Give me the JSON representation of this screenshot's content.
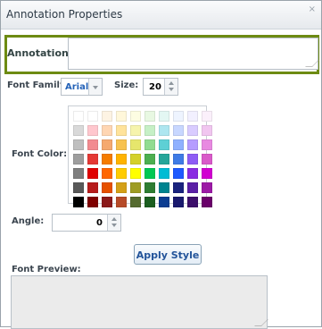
{
  "dialog": {
    "title": "Annotation Properties",
    "close_glyph": "×"
  },
  "annotation": {
    "label": "Annotation:",
    "value": ""
  },
  "font": {
    "family_label": "Font Family:",
    "family_value": "Arial",
    "size_label": "Size:",
    "size_value": "20"
  },
  "color": {
    "label": "Font Color:",
    "palette": [
      [
        "#ffffff",
        "#ffffff",
        "#fdf3e3",
        "#fff7da",
        "#fdfde2",
        "#e8f8e2",
        "#e3f7f3",
        "#eef4ff",
        "#f2f0ff",
        "#fbf0fb"
      ],
      [
        "#d9d9d9",
        "#ffc7ce",
        "#ffd6b3",
        "#ffe39b",
        "#f6f4ad",
        "#c6f0c6",
        "#aee6f0",
        "#c8d7ff",
        "#d9ccff",
        "#f1c6f0"
      ],
      [
        "#bfbfbf",
        "#f28b90",
        "#f5a96f",
        "#f7c24f",
        "#e6e66c",
        "#91dc91",
        "#5ed0d5",
        "#8fb0ff",
        "#b59cff",
        "#e889e1"
      ],
      [
        "#9e9e9e",
        "#e53935",
        "#f57c00",
        "#ffb300",
        "#d4d12a",
        "#4caf50",
        "#26a69a",
        "#3f7be6",
        "#8e5cf5",
        "#d95ac9"
      ],
      [
        "#7f7f7f",
        "#e00000",
        "#ff6600",
        "#ffcc00",
        "#ffff00",
        "#00c853",
        "#00bcd4",
        "#1e5aff",
        "#8a2be2",
        "#d100d1"
      ],
      [
        "#595959",
        "#b71c1c",
        "#e65100",
        "#d4a017",
        "#9e9d24",
        "#2e7d32",
        "#00838f",
        "#1a237e",
        "#5b1fa6",
        "#9c1aa6"
      ],
      [
        "#000000",
        "#7f0000",
        "#8b1a1a",
        "#b74b28",
        "#556b2f",
        "#1b5e20",
        "#0b3d91",
        "#1a1a6e",
        "#3d0f6b",
        "#6a006a"
      ]
    ]
  },
  "angle": {
    "label": "Angle:",
    "value": "0"
  },
  "apply_label": "Apply Style",
  "preview": {
    "label": "Font Preview:"
  }
}
